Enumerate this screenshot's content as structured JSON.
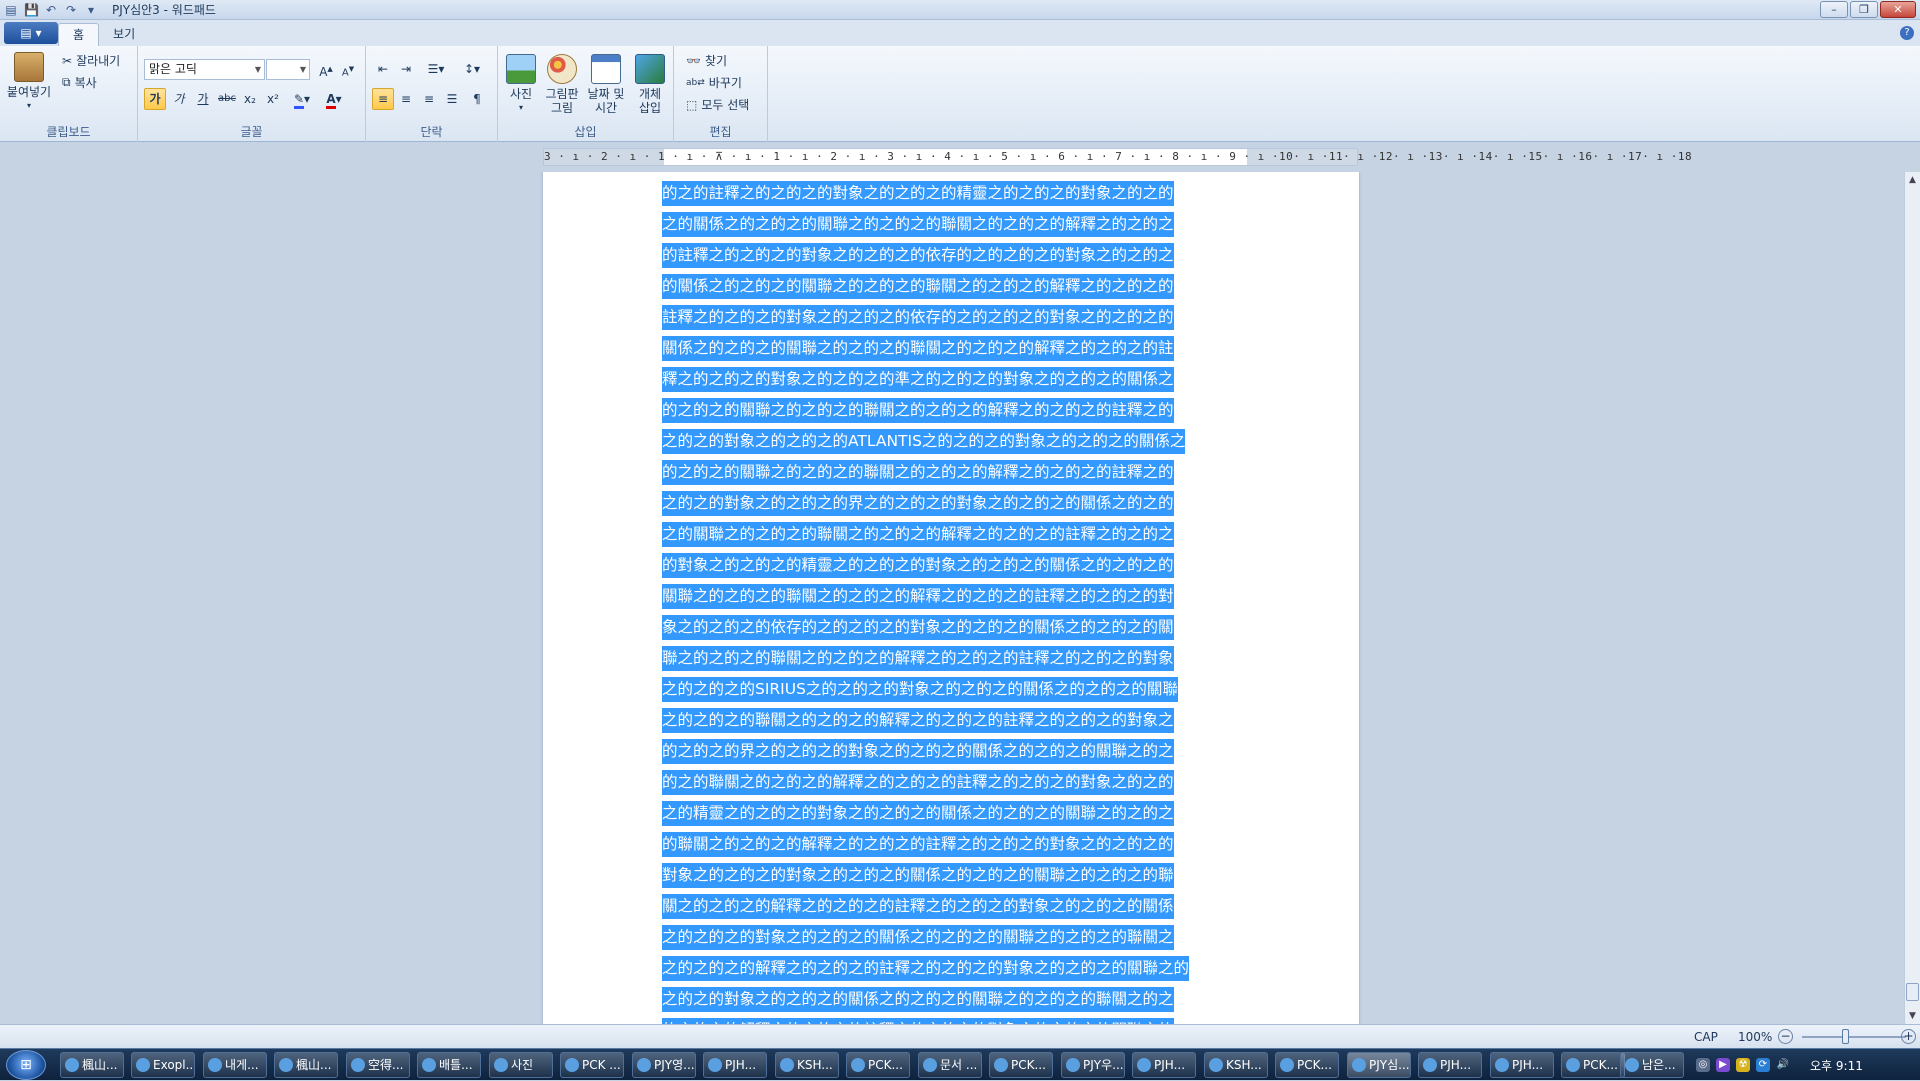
{
  "window": {
    "title": "PJY심안3 - 워드패드"
  },
  "tabs": [
    {
      "label": "홈",
      "active": true
    },
    {
      "label": "보기",
      "active": false
    }
  ],
  "ribbon": {
    "clipboard": {
      "paste": "붙여넣기",
      "cut": "잘라내기",
      "copy": "복사",
      "label": "클립보드"
    },
    "font": {
      "family": "맑은 고딕",
      "size": "",
      "bold": "가",
      "italic": "가",
      "underline": "가",
      "strike": "abc",
      "sub": "x₂",
      "sup": "x²",
      "label": "글꼴"
    },
    "paragraph": {
      "label": "단락"
    },
    "insert": {
      "picture": "사진",
      "paint1": "그림판",
      "paint2": "그림",
      "datetime1": "날짜 및",
      "datetime2": "시간",
      "object1": "개체",
      "object2": "삽입",
      "label": "삽입"
    },
    "editing": {
      "find": "찾기",
      "replace": "바꾸기",
      "selectall": "모두 선택",
      "label": "편집"
    }
  },
  "ruler": {
    "ticks": "3 · ı · 2 · ı · 1 · ı · ⊼ · ı · 1 · ı · 2 · ı · 3 · ı · 4 · ı · 5 · ı · 6 · ı · 7 · ı · 8 · ı · 9 · ı ·10· ı ·11· ı ·12· ı ·13· ı ·14· ı ·15· ı ·16· ı ·17· ı ·18"
  },
  "document": {
    "lines": [
      "的之的註釋之的之的之的對象之的之的之的精靈之的之的之的對象之的之的",
      "之的關係之的之的之的關聯之的之的之的聯關之的之的之的解釋之的之的之",
      "的註釋之的之的之的對象之的之的之的依存的之的之的之的對象之的之的之",
      "的關係之的之的之的關聯之的之的之的聯關之的之的之的解釋之的之的之的",
      "註釋之的之的之的對象之的之的之的依存的之的之的之的對象之的之的之的",
      "關係之的之的之的關聯之的之的之的聯關之的之的之的解釋之的之的之的註",
      "釋之的之的之的對象之的之的之的準之的之的之的對象之的之的之的關係之",
      "的之的之的關聯之的之的之的聯關之的之的之的解釋之的之的之的註釋之的",
      "之的之的對象之的之的之的ATLANTIS之的之的之的對象之的之的之的關係之",
      "的之的之的關聯之的之的之的聯關之的之的之的解釋之的之的之的註釋之的",
      "之的之的對象之的之的之的界之的之的之的對象之的之的之的關係之的之的",
      "之的關聯之的之的之的聯關之的之的之的解釋之的之的之的註釋之的之的之",
      "的對象之的之的之的精靈之的之的之的對象之的之的之的關係之的之的之的",
      "關聯之的之的之的聯關之的之的之的解釋之的之的之的註釋之的之的之的對",
      "象之的之的之的依存的之的之的之的對象之的之的之的關係之的之的之的關",
      "聯之的之的之的聯關之的之的之的解釋之的之的之的註釋之的之的之的對象",
      "之的之的之的SIRIUS之的之的之的對象之的之的之的關係之的之的之的關聯",
      "之的之的之的聯關之的之的之的解釋之的之的之的註釋之的之的之的對象之",
      "的之的之的界之的之的之的對象之的之的之的關係之的之的之的關聯之的之",
      "的之的聯關之的之的之的解釋之的之的之的註釋之的之的之的對象之的之的",
      "之的精靈之的之的之的對象之的之的之的關係之的之的之的關聯之的之的之",
      "的聯關之的之的之的解釋之的之的之的註釋之的之的之的對象之的之的之的",
      "對象之的之的之的對象之的之的之的關係之的之的之的關聯之的之的之的聯",
      "關之的之的之的解釋之的之的之的註釋之的之的之的對象之的之的之的關係",
      "之的之的之的對象之的之的之的關係之的之的之的關聯之的之的之的聯關之",
      "之的之的之的解釋之的之的之的註釋之的之的之的對象之的之的之的關聯之的",
      "之的之的對象之的之的之的關係之的之的之的關聯之的之的之的聯關之的之",
      "的之的之的解釋之的之的之的註釋之的之的之的對象之的之的之的關聯之的"
    ]
  },
  "statusbar": {
    "caps": "CAP",
    "zoom": "100%",
    "zoom_minus": "−",
    "zoom_plus": "+"
  },
  "taskbar": {
    "start": "⊞",
    "items": [
      {
        "label": "楓山..."
      },
      {
        "label": "Exopl..."
      },
      {
        "label": "내게..."
      },
      {
        "label": "楓山..."
      },
      {
        "label": "空得..."
      },
      {
        "label": "배틀..."
      },
      {
        "label": "사진"
      },
      {
        "label": "PCK ..."
      },
      {
        "label": "PJY영..."
      },
      {
        "label": "PJH..."
      },
      {
        "label": "KSH..."
      },
      {
        "label": "PCK..."
      },
      {
        "label": "문서 ..."
      },
      {
        "label": "PCK..."
      },
      {
        "label": "PJY우..."
      },
      {
        "label": "PJH..."
      },
      {
        "label": "KSH..."
      },
      {
        "label": "PCK..."
      },
      {
        "label": "PJY심..."
      },
      {
        "label": "PJH..."
      },
      {
        "label": "PJH..."
      },
      {
        "label": "PCK..."
      },
      {
        "label": "남은..."
      }
    ],
    "clock": "오후 9:11"
  }
}
